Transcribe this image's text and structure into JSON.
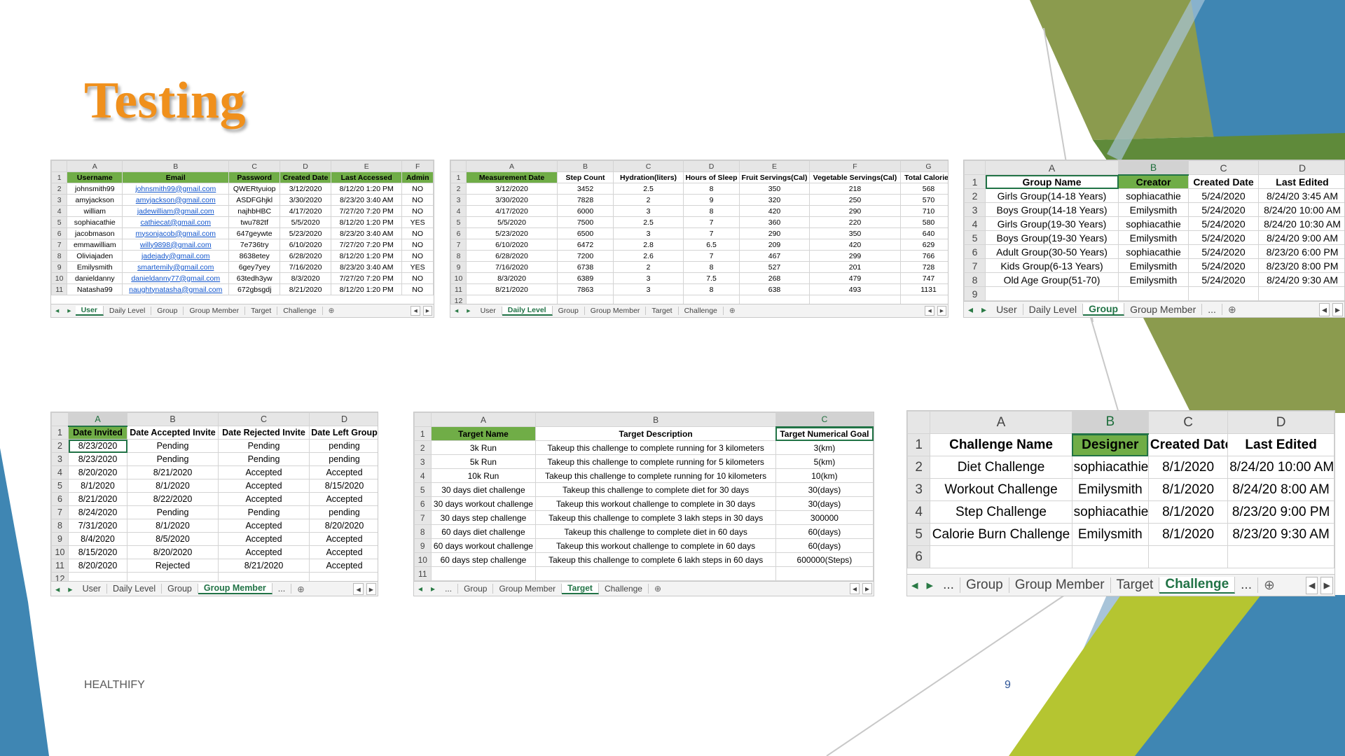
{
  "slide": {
    "title": "Testing",
    "footer": "HEALTHIFY",
    "page_number": "9"
  },
  "colors": {
    "title": "#f0901c",
    "header_green": "#70ad47",
    "excel_green": "#217346",
    "deco_olive": "#8b9b4e",
    "deco_blue": "#3f86b3"
  },
  "sheets": [
    {
      "name": "user-sheet",
      "cols": [
        "A",
        "B",
        "C",
        "D",
        "E",
        "F"
      ],
      "rows": [
        [
          "1",
          "Username",
          "Email",
          "Password",
          "Created Date",
          "Last Accessed",
          "Admin"
        ],
        [
          "2",
          "johnsmith99",
          "johnsmith99@gmail.com",
          "QWERtyuiop",
          "3/12/2020",
          "8/12/20 1:20 PM",
          "NO"
        ],
        [
          "3",
          "amyjackson",
          "amyjackson@gmail.com",
          "ASDFGhjkl",
          "3/30/2020",
          "8/23/20 3:40 AM",
          "NO"
        ],
        [
          "4",
          "william",
          "jadewilliam@gmail.com",
          "najhbHBC",
          "4/17/2020",
          "7/27/20 7:20 PM",
          "NO"
        ],
        [
          "5",
          "sophiacathie",
          "cathiecat@gmail.com",
          "twu782tf",
          "5/5/2020",
          "8/12/20 1:20 PM",
          "YES"
        ],
        [
          "6",
          "jacobmason",
          "mysonjacob@gmail.com",
          "647geywte",
          "5/23/2020",
          "8/23/20 3:40 AM",
          "NO"
        ],
        [
          "7",
          "emmawilliam",
          "willy9898@gmail.com",
          "7e736try",
          "6/10/2020",
          "7/27/20 7:20 PM",
          "NO"
        ],
        [
          "8",
          "Oliviajaden",
          "jadejady@gmail.com",
          "8638etey",
          "6/28/2020",
          "8/12/20 1:20 PM",
          "NO"
        ],
        [
          "9",
          "Emilysmith",
          "smartemily@gmail.com",
          "6gey7yey",
          "7/16/2020",
          "8/23/20 3:40 AM",
          "YES"
        ],
        [
          "10",
          "danieldanny",
          "danieldanny77@gmail.com",
          "63tedh3yw",
          "8/3/2020",
          "7/27/20 7:20 PM",
          "NO"
        ],
        [
          "11",
          "Natasha99",
          "naughtynatasha@gmail.com",
          "672gbsgdj",
          "8/21/2020",
          "8/12/20 1:20 PM",
          "NO"
        ]
      ],
      "tabs": [
        "User",
        "Daily Level",
        "Group",
        "Group Member",
        "Target",
        "Challenge"
      ]
    },
    {
      "name": "daily-level-sheet",
      "cols": [
        "A",
        "B",
        "C",
        "D",
        "E",
        "F",
        "G"
      ],
      "rows": [
        [
          "1",
          "Measurement Date",
          "Step Count",
          "Hydration(liters)",
          "Hours of Sleep",
          "Fruit Servings(Cal)",
          "Vegetable Servings(Cal)",
          "Total Calories"
        ],
        [
          "2",
          "3/12/2020",
          "3452",
          "2.5",
          "8",
          "350",
          "218",
          "568"
        ],
        [
          "3",
          "3/30/2020",
          "7828",
          "2",
          "9",
          "320",
          "250",
          "570"
        ],
        [
          "4",
          "4/17/2020",
          "6000",
          "3",
          "8",
          "420",
          "290",
          "710"
        ],
        [
          "5",
          "5/5/2020",
          "7500",
          "2.5",
          "7",
          "360",
          "220",
          "580"
        ],
        [
          "6",
          "5/23/2020",
          "6500",
          "3",
          "7",
          "290",
          "350",
          "640"
        ],
        [
          "7",
          "6/10/2020",
          "6472",
          "2.8",
          "6.5",
          "209",
          "420",
          "629"
        ],
        [
          "8",
          "6/28/2020",
          "7200",
          "2.6",
          "7",
          "467",
          "299",
          "766"
        ],
        [
          "9",
          "7/16/2020",
          "6738",
          "2",
          "8",
          "527",
          "201",
          "728"
        ],
        [
          "10",
          "8/3/2020",
          "6389",
          "3",
          "7.5",
          "268",
          "479",
          "747"
        ],
        [
          "11",
          "8/21/2020",
          "7863",
          "3",
          "8",
          "638",
          "493",
          "1131"
        ],
        [
          "12",
          "",
          "",
          "",
          "",
          "",
          "",
          ""
        ]
      ],
      "tabs": [
        "User",
        "Daily Level",
        "Group",
        "Group Member",
        "Target",
        "Challenge"
      ]
    },
    {
      "name": "group-sheet",
      "cols": [
        "A",
        "B",
        "C",
        "D"
      ],
      "rows": [
        [
          "1",
          "Group Name",
          "Creator",
          "Created Date",
          "Last Edited"
        ],
        [
          "2",
          "Girls Group(14-18 Years)",
          "sophiacathie",
          "5/24/2020",
          "8/24/20 3:45 AM"
        ],
        [
          "3",
          "Boys Group(14-18 Years)",
          "Emilysmith",
          "5/24/2020",
          "8/24/20 10:00 AM"
        ],
        [
          "4",
          "Girls Group(19-30 Years)",
          "sophiacathie",
          "5/24/2020",
          "8/24/20 10:30 AM"
        ],
        [
          "5",
          "Boys Group(19-30 Years)",
          "Emilysmith",
          "5/24/2020",
          "8/24/20 9:00 AM"
        ],
        [
          "6",
          "Adult Group(30-50 Years)",
          "sophiacathie",
          "5/24/2020",
          "8/23/20 6:00 PM"
        ],
        [
          "7",
          "Kids Group(6-13 Years)",
          "Emilysmith",
          "5/24/2020",
          "8/23/20 8:00 PM"
        ],
        [
          "8",
          "Old Age Group(51-70)",
          "Emilysmith",
          "5/24/2020",
          "8/24/20 9:30 AM"
        ],
        [
          "9",
          "",
          "",
          "",
          ""
        ]
      ],
      "tabs": [
        "User",
        "Daily Level",
        "Group",
        "Group Member",
        "..."
      ]
    },
    {
      "name": "group-member-sheet",
      "cols": [
        "A",
        "B",
        "C",
        "D"
      ],
      "rows": [
        [
          "1",
          "Date Invited",
          "Date Accepted Invite",
          "Date Rejected Invite",
          "Date Left Group"
        ],
        [
          "2",
          "8/23/2020",
          "Pending",
          "Pending",
          "pending"
        ],
        [
          "3",
          "8/23/2020",
          "Pending",
          "Pending",
          "pending"
        ],
        [
          "4",
          "8/20/2020",
          "8/21/2020",
          "Accepted",
          "Accepted"
        ],
        [
          "5",
          "8/1/2020",
          "8/1/2020",
          "Accepted",
          "8/15/2020"
        ],
        [
          "6",
          "8/21/2020",
          "8/22/2020",
          "Accepted",
          "Accepted"
        ],
        [
          "7",
          "8/24/2020",
          "Pending",
          "Pending",
          "pending"
        ],
        [
          "8",
          "7/31/2020",
          "8/1/2020",
          "Accepted",
          "8/20/2020"
        ],
        [
          "9",
          "8/4/2020",
          "8/5/2020",
          "Accepted",
          "Accepted"
        ],
        [
          "10",
          "8/15/2020",
          "8/20/2020",
          "Accepted",
          "Accepted"
        ],
        [
          "11",
          "8/20/2020",
          "Rejected",
          "8/21/2020",
          "Accepted"
        ],
        [
          "12",
          "",
          "",
          "",
          ""
        ]
      ],
      "tabs": [
        "User",
        "Daily Level",
        "Group",
        "Group Member",
        "..."
      ]
    },
    {
      "name": "target-sheet",
      "cols": [
        "A",
        "B",
        "C"
      ],
      "rows": [
        [
          "1",
          "Target Name",
          "Target Description",
          "Target Numerical Goal"
        ],
        [
          "2",
          "3k Run",
          "Takeup this challenge to complete running for 3 kilometers",
          "3(km)"
        ],
        [
          "3",
          "5k Run",
          "Takeup this challenge to complete running for 5 kilometers",
          "5(km)"
        ],
        [
          "4",
          "10k Run",
          "Takeup this challenge to complete running for 10 kilometers",
          "10(km)"
        ],
        [
          "5",
          "30 days diet challenge",
          "Takeup this challenge to complete diet for 30 days",
          "30(days)"
        ],
        [
          "6",
          "30 days workout challenge",
          "Takeup this workout challenge to complete in 30 days",
          "30(days)"
        ],
        [
          "7",
          "30 days step challenge",
          "Takeup this challenge to complete 3 lakh steps in 30 days",
          "300000"
        ],
        [
          "8",
          "60 days diet challenge",
          "Takeup this challenge to complete diet in 60 days",
          "60(days)"
        ],
        [
          "9",
          "60 days workout challenge",
          "Takeup this workout challenge to complete in 60 days",
          "60(days)"
        ],
        [
          "10",
          "60 days step challenge",
          "Takeup this challenge to complete 6 lakh steps in 60 days",
          "600000(Steps)"
        ],
        [
          "11",
          "",
          "",
          ""
        ]
      ],
      "tabs": [
        "...",
        "Group",
        "Group Member",
        "Target",
        "Challenge"
      ]
    },
    {
      "name": "challenge-sheet",
      "cols": [
        "A",
        "B",
        "C",
        "D"
      ],
      "rows": [
        [
          "1",
          "Challenge Name",
          "Designer",
          "Created Date",
          "Last Edited"
        ],
        [
          "2",
          "Diet Challenge",
          "sophiacathie",
          "8/1/2020",
          "8/24/20 10:00 AM"
        ],
        [
          "3",
          "Workout Challenge",
          "Emilysmith",
          "8/1/2020",
          "8/24/20 8:00 AM"
        ],
        [
          "4",
          "Step Challenge",
          "sophiacathie",
          "8/1/2020",
          "8/23/20 9:00 PM"
        ],
        [
          "5",
          "Calorie Burn Challenge",
          "Emilysmith",
          "8/1/2020",
          "8/23/20 9:30 AM"
        ],
        [
          "6",
          "",
          "",
          "",
          ""
        ]
      ],
      "tabs": [
        "...",
        "Group",
        "Group Member",
        "Target",
        "Challenge",
        "..."
      ]
    }
  ]
}
